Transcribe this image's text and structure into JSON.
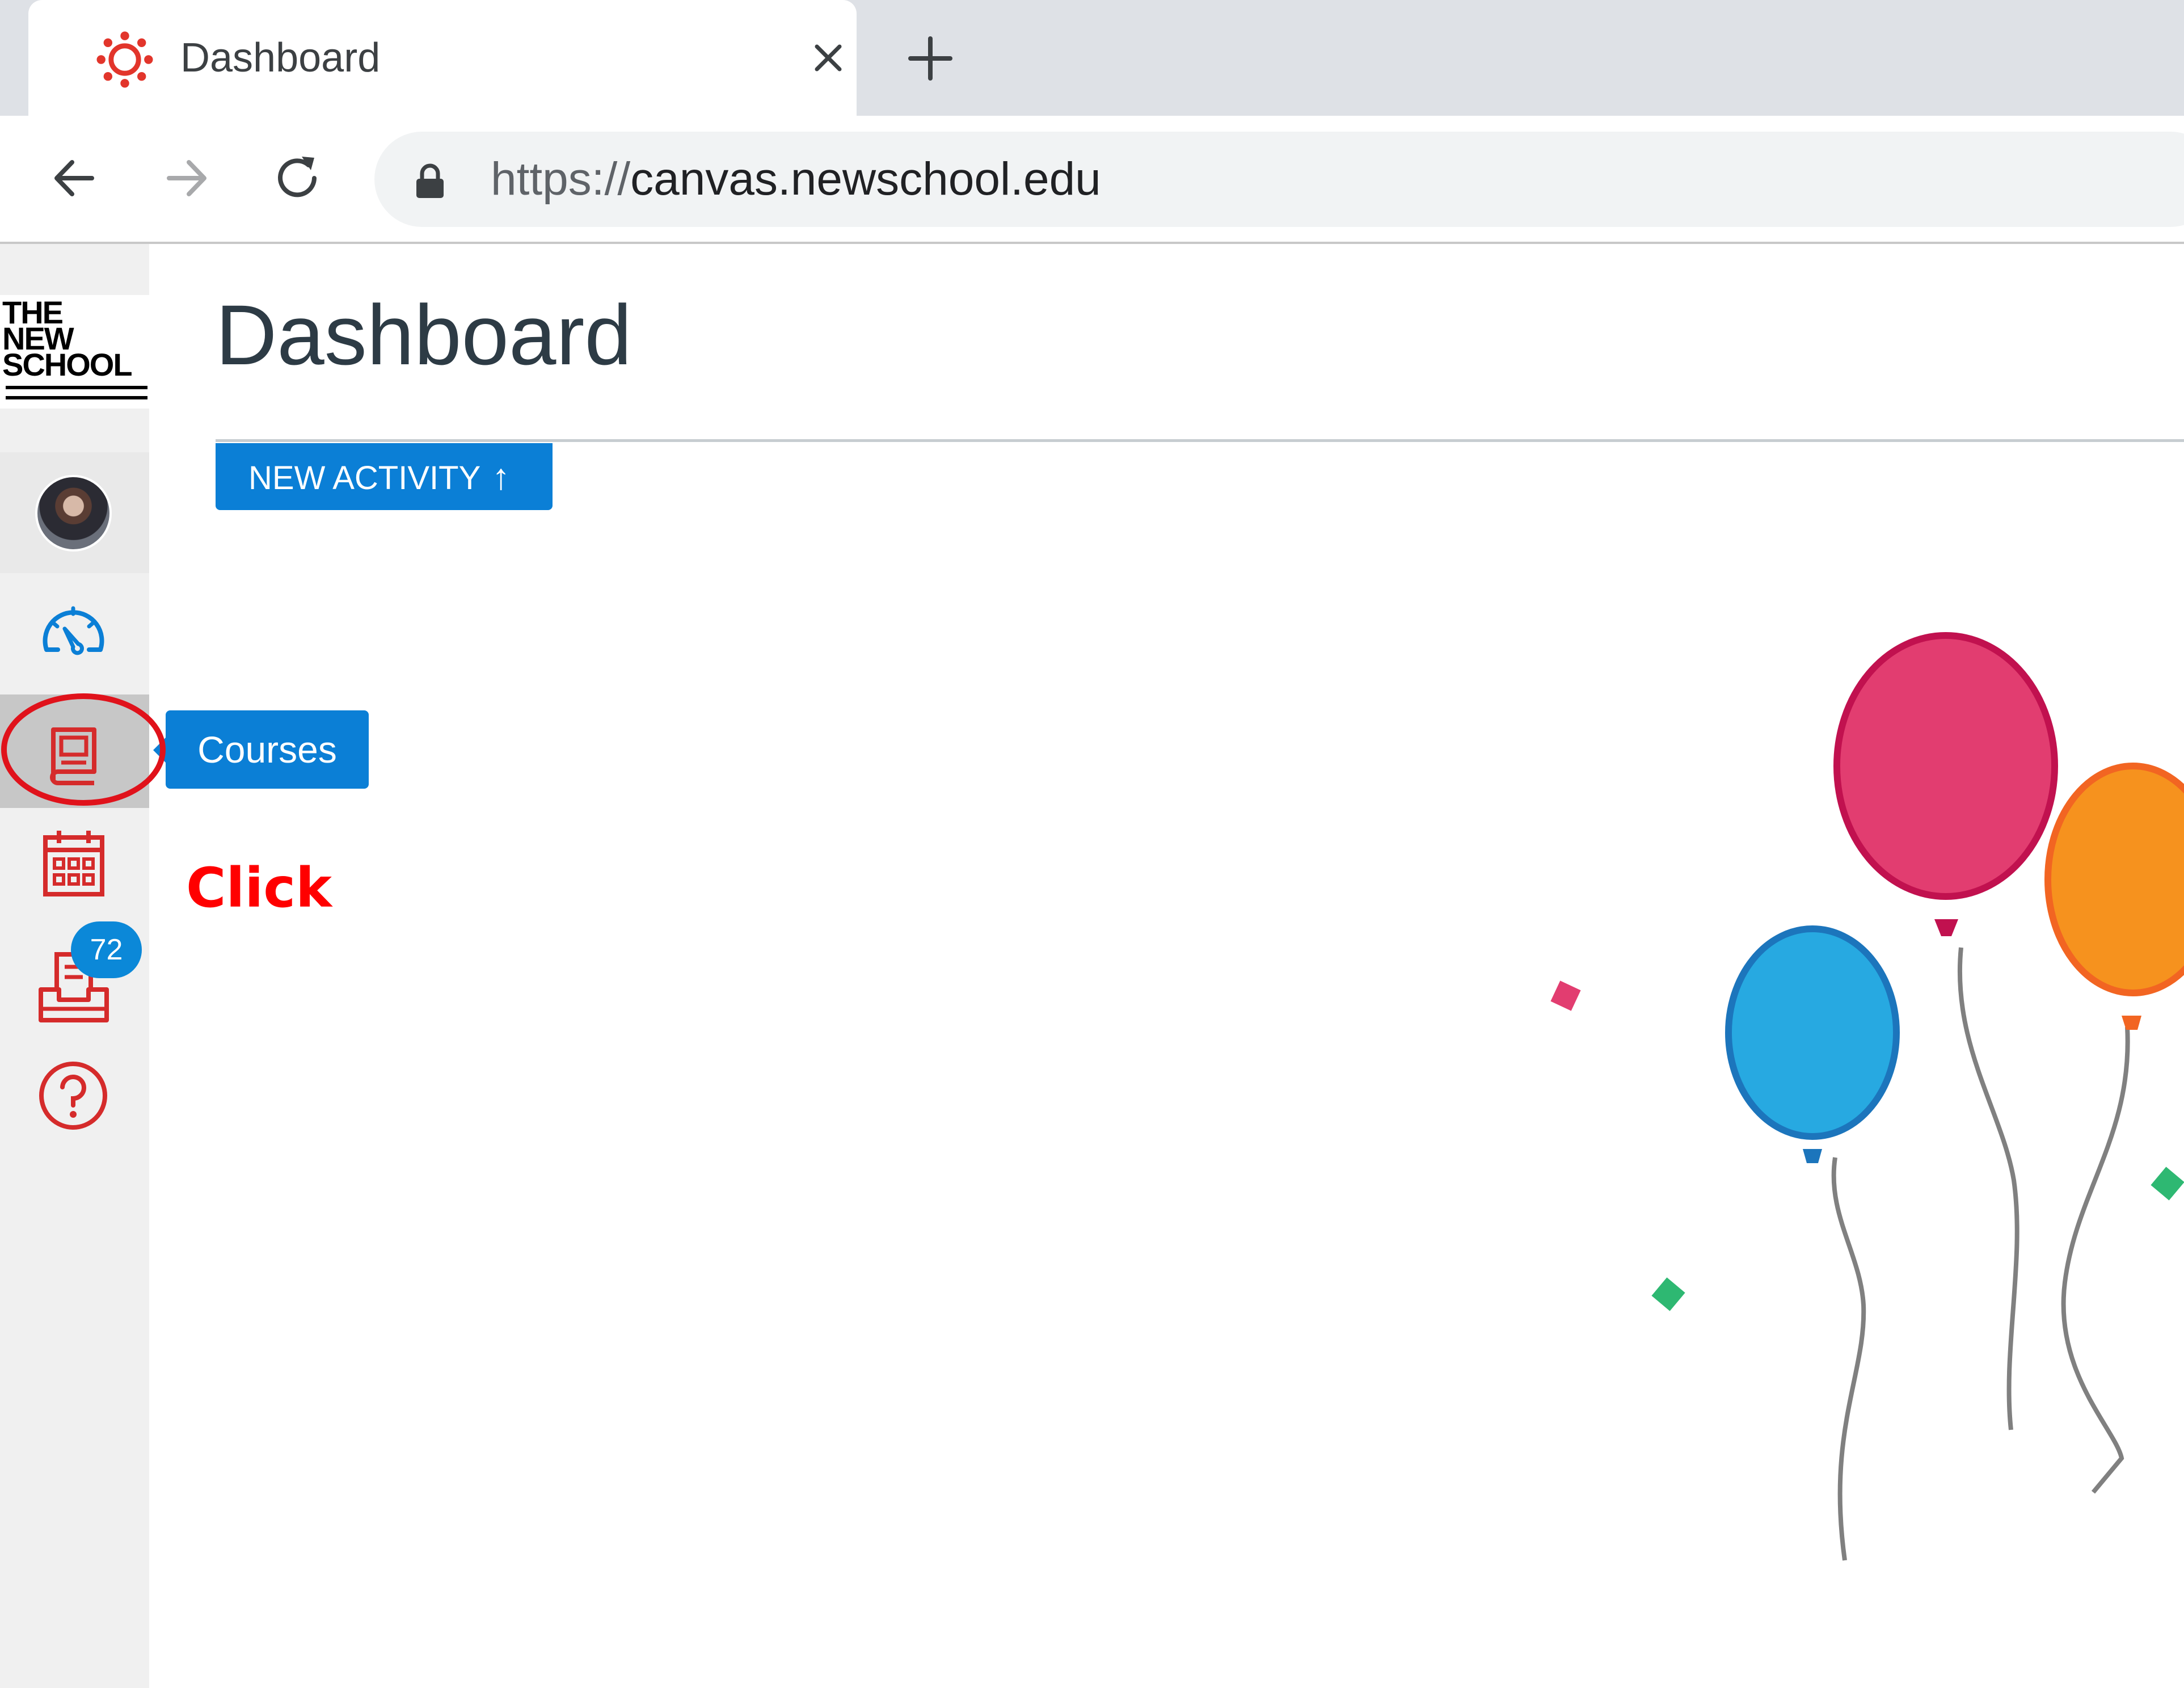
{
  "browser": {
    "tab": {
      "title": "Dashboard",
      "favicon": "canvas-logo-icon",
      "close_icon": "close-icon"
    },
    "new_tab_icon": "plus-icon",
    "nav": {
      "back": "back-arrow-icon",
      "forward": "forward-arrow-icon",
      "reload": "reload-icon"
    },
    "address": {
      "scheme": "https://",
      "host": "canvas.newschool.edu",
      "lock_icon": "lock-icon"
    }
  },
  "logo": {
    "line1": "THE",
    "line2": "NEW",
    "line3": "SCHOOL"
  },
  "global_nav": {
    "items": [
      {
        "name": "account",
        "icon": "avatar"
      },
      {
        "name": "dashboard",
        "icon": "speedometer-icon"
      },
      {
        "name": "courses",
        "icon": "book-icon",
        "tooltip": "Courses"
      },
      {
        "name": "calendar",
        "icon": "calendar-icon"
      },
      {
        "name": "inbox",
        "icon": "inbox-icon",
        "badge": "72"
      },
      {
        "name": "help",
        "icon": "help-icon"
      }
    ]
  },
  "page": {
    "title": "Dashboard",
    "new_activity_label": "NEW ACTIVITY",
    "new_activity_arrow": "↑"
  },
  "annotation": {
    "click_label": "Click",
    "color": "#ff0000"
  },
  "colors": {
    "canvas_blue": "#0b7fd6",
    "nav_icon_red": "#d52b2b",
    "dashboard_icon_blue": "#0b7fd6",
    "balloon_pink": "#e23d70",
    "balloon_orange": "#f6921e",
    "balloon_blue": "#27a9e1"
  }
}
